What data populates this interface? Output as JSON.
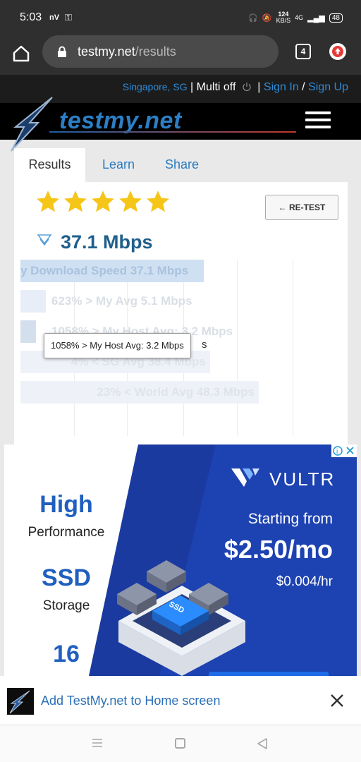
{
  "status_bar": {
    "time": "5:03",
    "carrier_badge": "nV",
    "net_speed_value": "124",
    "net_speed_unit": "KB/S",
    "network": "4G",
    "battery": "48"
  },
  "browser": {
    "url_host": "testmy.net",
    "url_path": "/results",
    "tab_count": "4"
  },
  "site_header": {
    "location": "Singapore, SG",
    "separator": "|",
    "multi": "Multi off",
    "sign_in": "Sign In",
    "slash": "/",
    "sign_up": "Sign Up",
    "logo_text": "testmy.net"
  },
  "tabs": [
    {
      "label": "Results"
    },
    {
      "label": "Learn"
    },
    {
      "label": "Share"
    }
  ],
  "result": {
    "rating_stars": 5,
    "retest_label": "← RE-TEST",
    "speed": "37.1 Mbps"
  },
  "chart_data": {
    "type": "bar",
    "orientation": "horizontal",
    "categories": [
      "y Download Speed 37.1 Mbps",
      "623% > My Avg 5.1 Mbps",
      "1058% > My Host Avg: 3.2 Mbps",
      "4% < SG Avg 38.4 Mbps",
      "23% < World Avg 48.3 Mbps"
    ],
    "values": [
      37.1,
      5.1,
      3.2,
      38.4,
      48.3
    ],
    "xlim": [
      0,
      60
    ],
    "colors": [
      "#cfe0f2",
      "#e8eef7",
      "#d4dfee",
      "#eef2f8",
      "#eef2f8"
    ],
    "grid": true
  },
  "tooltip": {
    "text": "1058% > My Host Avg: 3.2 Mbps",
    "tail": "s"
  },
  "ad": {
    "headline1": "High",
    "sub1": "Performance",
    "headline2": "SSD",
    "sub2": "Storage",
    "headline3": "16",
    "brand": "VULTR",
    "starting": "Starting from",
    "price": "$2.50/mo",
    "hourly": "$0.004/hr",
    "ssd_chip": "SSD"
  },
  "a2hs": {
    "text": "Add TestMy.net to Home screen"
  },
  "colors": {
    "accent_blue": "#2a7bbf",
    "speed_blue": "#1f5f8b",
    "star_yellow": "#f5c518",
    "ad_blue": "#1a3aa0"
  }
}
